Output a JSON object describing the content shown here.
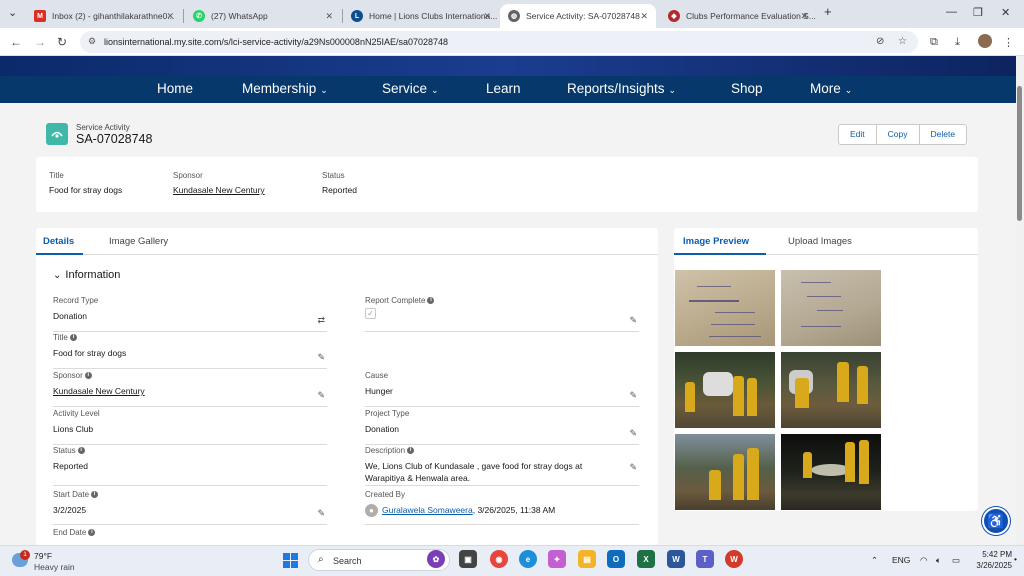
{
  "browser": {
    "tabs": [
      {
        "label": "Inbox (2) - gihanthilakarathne0...",
        "icon": "gmail-icon",
        "color": "#d93025",
        "glyph": "M"
      },
      {
        "label": "(27) WhatsApp",
        "icon": "whatsapp-icon",
        "color": "#25d366",
        "glyph": "✆"
      },
      {
        "label": "Home | Lions Clubs Internationa...",
        "icon": "lions-icon",
        "color": "#0d4f8c",
        "glyph": "L"
      },
      {
        "label": "Service Activity: SA-07028748",
        "icon": "salesforce-icon",
        "color": "#5f6368",
        "glyph": "◍"
      },
      {
        "label": "Clubs Performance Evaluation S...",
        "icon": "lions-icon",
        "color": "#b42a2a",
        "glyph": "◆"
      }
    ],
    "new_tab": "+",
    "url": "lionsinternational.my.site.com/s/lci-service-activity/a29Ns000008nN25IAE/sa07028748"
  },
  "nav": {
    "items": [
      {
        "label": "Home",
        "has_menu": false
      },
      {
        "label": "Membership",
        "has_menu": true
      },
      {
        "label": "Service",
        "has_menu": true
      },
      {
        "label": "Learn",
        "has_menu": false
      },
      {
        "label": "Reports/Insights",
        "has_menu": true
      },
      {
        "label": "Shop",
        "has_menu": false
      },
      {
        "label": "More",
        "has_menu": true
      }
    ]
  },
  "record": {
    "type_label": "Service Activity",
    "title": "SA-07028748",
    "actions": [
      "Edit",
      "Copy",
      "Delete"
    ]
  },
  "highlights": {
    "title_label": "Title",
    "title_value": "Food for stray dogs",
    "sponsor_label": "Sponsor",
    "sponsor_value": "Kundasale New Century",
    "status_label": "Status",
    "status_value": "Reported"
  },
  "details": {
    "tabs": [
      "Details",
      "Image Gallery"
    ],
    "section": "Information",
    "fields": {
      "record_type": {
        "label": "Record Type",
        "value": "Donation"
      },
      "report_complete": {
        "label": "Report Complete",
        "checked": true
      },
      "title": {
        "label": "Title",
        "value": "Food for stray dogs"
      },
      "sponsor": {
        "label": "Sponsor",
        "value": "Kundasale New Century"
      },
      "cause": {
        "label": "Cause",
        "value": "Hunger"
      },
      "activity_level": {
        "label": "Activity Level",
        "value": "Lions Club"
      },
      "project_type": {
        "label": "Project Type",
        "value": "Donation"
      },
      "status": {
        "label": "Status",
        "value": "Reported"
      },
      "description": {
        "label": "Description",
        "value": "We, Lions Club of Kundasale , gave food for stray dogs at Warapitiya & Henwala area."
      },
      "start_date": {
        "label": "Start Date",
        "value": "3/2/2025"
      },
      "created_by": {
        "label": "Created By",
        "user": "Guralawela Somaweera",
        "timestamp": ", 3/26/2025, 11:38 AM"
      },
      "end_date": {
        "label": "End Date"
      }
    }
  },
  "images": {
    "tabs": [
      "Image Preview",
      "Upload Images"
    ]
  },
  "taskbar": {
    "weather_temp": "79°F",
    "weather_desc": "Heavy rain",
    "weather_badge": "1",
    "search_placeholder": "Search",
    "language": "ENG",
    "time": "5:42 PM",
    "date": "3/26/2025"
  },
  "colors": {
    "nav_bg": "#06386b",
    "link": "#0b5cab",
    "record_icon": "#3fb8a9"
  }
}
